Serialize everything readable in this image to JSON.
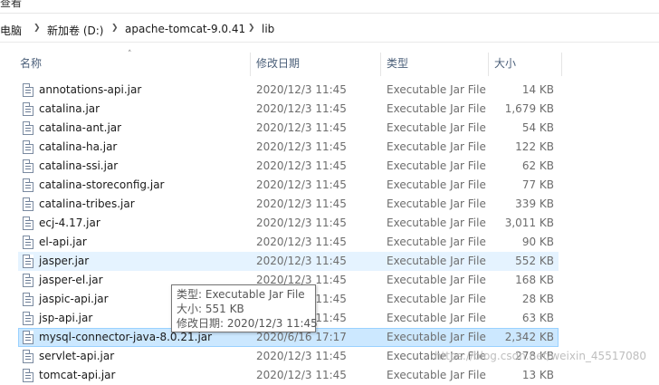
{
  "ribbon": {
    "label": "查看"
  },
  "breadcrumb": {
    "items": [
      "此电脑",
      "新加卷 (D:)",
      "apache-tomcat-9.0.41",
      "lib"
    ]
  },
  "columns": {
    "name": "名称",
    "date": "修改日期",
    "type": "类型",
    "size": "大小"
  },
  "files": [
    {
      "name": "annotations-api.jar",
      "date": "2020/12/3 11:45",
      "type": "Executable Jar File",
      "size": "14 KB"
    },
    {
      "name": "catalina.jar",
      "date": "2020/12/3 11:45",
      "type": "Executable Jar File",
      "size": "1,679 KB"
    },
    {
      "name": "catalina-ant.jar",
      "date": "2020/12/3 11:45",
      "type": "Executable Jar File",
      "size": "54 KB"
    },
    {
      "name": "catalina-ha.jar",
      "date": "2020/12/3 11:45",
      "type": "Executable Jar File",
      "size": "122 KB"
    },
    {
      "name": "catalina-ssi.jar",
      "date": "2020/12/3 11:45",
      "type": "Executable Jar File",
      "size": "62 KB"
    },
    {
      "name": "catalina-storeconfig.jar",
      "date": "2020/12/3 11:45",
      "type": "Executable Jar File",
      "size": "77 KB"
    },
    {
      "name": "catalina-tribes.jar",
      "date": "2020/12/3 11:45",
      "type": "Executable Jar File",
      "size": "339 KB"
    },
    {
      "name": "ecj-4.17.jar",
      "date": "2020/12/3 11:45",
      "type": "Executable Jar File",
      "size": "3,011 KB"
    },
    {
      "name": "el-api.jar",
      "date": "2020/12/3 11:45",
      "type": "Executable Jar File",
      "size": "90 KB"
    },
    {
      "name": "jasper.jar",
      "date": "2020/12/3 11:45",
      "type": "Executable Jar File",
      "size": "552 KB",
      "state": "hover"
    },
    {
      "name": "jasper-el.jar",
      "date": "2020/12/3 11:45",
      "type": "Executable Jar File",
      "size": "168 KB"
    },
    {
      "name": "jaspic-api.jar",
      "date": "2020/12/3 11:45",
      "type": "Executable Jar File",
      "size": "28 KB"
    },
    {
      "name": "jsp-api.jar",
      "date": "2020/12/3 11:45",
      "type": "Executable Jar File",
      "size": "63 KB"
    },
    {
      "name": "mysql-connector-java-8.0.21.jar",
      "date": "2020/6/16 17:17",
      "type": "Executable Jar File",
      "size": "2,342 KB",
      "state": "selected"
    },
    {
      "name": "servlet-api.jar",
      "date": "2020/12/3 11:45",
      "type": "Executable Jar File",
      "size": "278 KB"
    },
    {
      "name": "tomcat-api.jar",
      "date": "2020/12/3 11:45",
      "type": "Executable Jar File",
      "size": "13 KB"
    }
  ],
  "tooltip": {
    "type_line": "类型: Executable Jar File",
    "size_line": "大小: 551 KB",
    "date_line": "修改日期: 2020/12/3 11:45"
  },
  "watermark": "https://blog.csdn.net/weixin_45517080",
  "colors": {
    "hover_bg": "#e5f3ff",
    "selected_bg": "#cce8ff",
    "selected_border": "#99d1ff",
    "header_text": "#4c607a"
  }
}
